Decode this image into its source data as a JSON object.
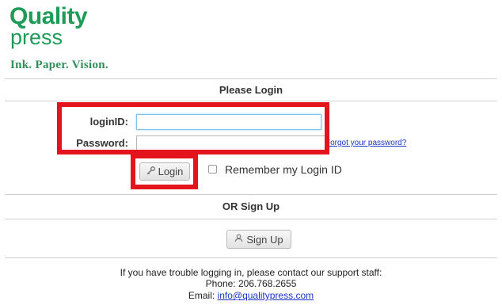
{
  "brand": {
    "logo_line1": "Quality",
    "logo_line2": "press",
    "tagline": "Ink. Paper. Vision.",
    "color": "#1f9b58"
  },
  "login_section": {
    "title": "Please Login",
    "login_id_label": "loginID:",
    "login_id_value": "",
    "password_label": "Password:",
    "password_value": "",
    "forgot_link": "Forgot your password?",
    "login_button": "Login",
    "login_button_icon": "key-icon",
    "remember_label": "Remember my Login ID",
    "remember_checked": false
  },
  "signup_section": {
    "title": "OR Sign Up",
    "signup_button": "Sign Up",
    "signup_button_icon": "user-icon"
  },
  "footer": {
    "support_text": "If you have trouble logging in, please contact our support staff:",
    "phone_line": "Phone: 206.768.2655",
    "email_label": "Email:",
    "email": "info@qualitypress.com",
    "link_color": "#1a35c9"
  },
  "highlight_color": "#e4141c"
}
